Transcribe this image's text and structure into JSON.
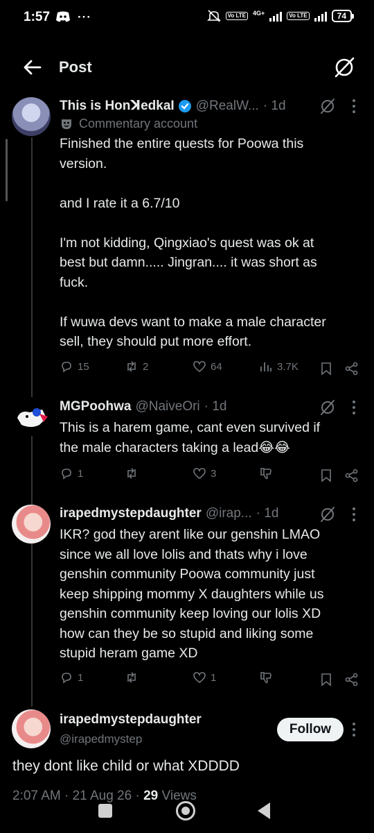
{
  "status": {
    "time": "1:57",
    "left_icons": [
      "discord-icon",
      "more-dots-icon"
    ],
    "net_label": "4G+",
    "volte_1": "Vo LTE",
    "volte_2": "Vo LTE",
    "battery": "74"
  },
  "topbar": {
    "title": "Post",
    "back_icon": "arrow-left-icon",
    "grok_icon": "grok-icon"
  },
  "tweet1": {
    "name": "This is HonꓘedkaI",
    "handle": "@RealW...",
    "time": "· 1d",
    "commentary": "Commentary account",
    "text": "Finished the entire quests for Poowa this\nversion.\n\nand I rate it a 6.7/10\n\nI'm not kidding, Qingxiao's quest was ok at\nbest but damn..... Jingran.... it was short as\nfuck.\n\nIf wuwa devs want to make a male character\nsell, they should put more effort.",
    "replies": "15",
    "reposts": "2",
    "likes": "64",
    "views": "3.7K"
  },
  "tweet2": {
    "name": "MGPoohwa",
    "handle": "@NaiveOri",
    "time": "· 1d",
    "text": "This is a harem game, cant even survived if\nthe male characters taking a lead😂😂",
    "replies": "1",
    "reposts": "",
    "likes": "3"
  },
  "tweet3": {
    "name": "irapedmystepdaughter",
    "handle": "@irap...",
    "time": "· 1d",
    "text": "IKR? god they arent like our genshin LMAO\nsince we all love lolis and thats why i love\ngenshin community Poowa community just\nkeep shipping mommy X daughters while us\ngenshin community keep loving our lolis XD\nhow can they be so stupid and liking some\nstupid heram game XD",
    "replies": "1",
    "reposts": "",
    "likes": "1"
  },
  "main": {
    "name": "irapedmystepdaughter",
    "handle": "@irapedmystep",
    "follow": "Follow",
    "text": "they dont like child or what XDDDD",
    "time": "2:07 AM",
    "date": "21 Aug 26",
    "views_count": "29",
    "views_label": "Views"
  }
}
